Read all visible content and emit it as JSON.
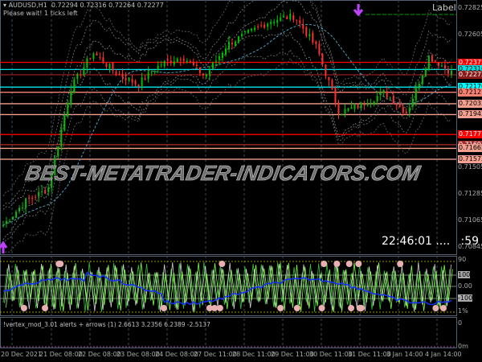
{
  "header": {
    "symbol": "AUDUSD,H1",
    "ohlc": "0.72294 0.72316 0.72264 0.72277",
    "status": "Please wait! 1 ticks left"
  },
  "label_text": "Label",
  "watermark": "BEST-METATRADER-INDICATORS.COM",
  "clock": {
    "time": "22:46:01",
    "dots": "....",
    "seconds": ":59"
  },
  "price_axis": [
    "0.72825",
    "0.72605",
    "0.71505",
    "0.71285",
    "0.71065",
    "0.70845"
  ],
  "levels": [
    {
      "price": "0.72375",
      "color": "#ff0000",
      "text": "#ffffff"
    },
    {
      "price": "0.72316",
      "color": "#00e0e0",
      "text": "#000000"
    },
    {
      "price": "0.72272",
      "color": "#8b1a1a",
      "text": "#ffffff"
    },
    {
      "price": "0.72170",
      "color": "#00ffff",
      "text": "#000000"
    },
    {
      "price": "0.72127",
      "color": "#fa8072",
      "text": "#000000"
    },
    {
      "price": "0.72032",
      "color": "#f4a090",
      "text": "#000000"
    },
    {
      "price": "0.71942",
      "color": "#f4a090",
      "text": "#000000"
    },
    {
      "price": "0.71777",
      "color": "#ff0000",
      "text": "#ffffff"
    },
    {
      "price": "0.71693",
      "color": "#a52a2a",
      "text": "#ffffff"
    },
    {
      "price": "0.71662",
      "color": "#f4a090",
      "text": "#000000"
    },
    {
      "price": "0.71572",
      "color": "#f4a090",
      "text": "#000000"
    }
  ],
  "price_path": [
    0.71025,
    0.71225,
    0.71325,
    0.72158,
    0.72458,
    0.72292,
    0.72192,
    0.72358,
    0.72425,
    0.72258,
    0.72525,
    0.72625,
    0.72725,
    0.72758,
    0.72492,
    0.71958,
    0.72025,
    0.72125,
    0.71958,
    0.72425,
    0.72292
  ],
  "oscillator": {
    "axis": [
      "90",
      "100",
      "0.00",
      "-100",
      "1%"
    ]
  },
  "subwindow2": {
    "title": "!vertex_mod_3.01 alerts + arrows (1) 2.6613 3.2356 6.2389 -2.5137",
    "axis": [
      "0",
      "0m"
    ]
  },
  "time_axis": [
    "20 Dec 2021",
    "21 Dec 08:00",
    "22 Dec 08:00",
    "23 Dec 08:00",
    "24 Dec 08:00",
    "27 Dec 11:00",
    "28 Dec 11:00",
    "29 Dec 11:00",
    "30 Dec 11:00",
    "31 Dec 11:00",
    "3 Jan 14:00",
    "4 Jan 14:00"
  ],
  "colors": {
    "bull": "#00c000",
    "bear": "#ff3030",
    "osc_line": "#1030ff",
    "grid": "#3a4a5a"
  }
}
